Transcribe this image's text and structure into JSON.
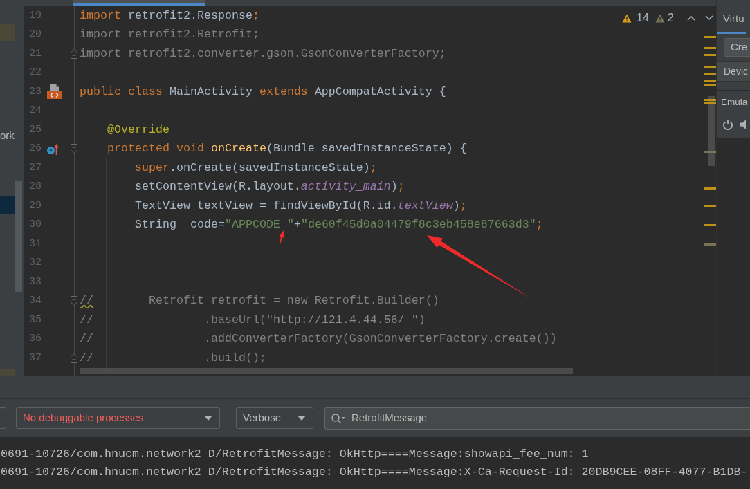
{
  "editor_tabs": [
    {
      "selected": true
    },
    {
      "selected": false
    }
  ],
  "project_tree": {
    "rows": [
      {
        "selected": false,
        "highlighted": true
      },
      {
        "label": "ork",
        "selected": false,
        "highlighted": false
      },
      {
        "selected": true,
        "highlighted": false
      },
      {
        "selected": false,
        "highlighted": true
      }
    ]
  },
  "editor": {
    "inspections": [
      {
        "kind": "warning",
        "count": "14"
      },
      {
        "kind": "weak_warning",
        "count": "2"
      }
    ],
    "lines": [
      {
        "number": "19",
        "tokens": [
          {
            "kind": "keyword",
            "text": "import"
          },
          {
            "kind": "plain",
            "text": " retrofit2.Response"
          },
          {
            "kind": "keyword",
            "text": ";"
          }
        ]
      },
      {
        "number": "20",
        "tokens": [
          {
            "kind": "unused",
            "text": "import retrofit2.Retrofit;"
          }
        ]
      },
      {
        "number": "21",
        "fold_marker": {
          "kind": "end"
        },
        "tokens": [
          {
            "kind": "unused",
            "text": "import retrofit2.converter.gson.GsonConverterFactory;"
          }
        ]
      },
      {
        "number": "22"
      },
      {
        "number": "23",
        "gutter_marker": {
          "kind": "layout"
        },
        "tokens": [
          {
            "kind": "keyword",
            "text": "public class "
          },
          {
            "kind": "plain",
            "text": "MainActivity"
          },
          {
            "kind": "keyword",
            "text": " extends "
          },
          {
            "kind": "plain",
            "text": "AppCompatActivity {"
          }
        ]
      },
      {
        "number": "24"
      },
      {
        "number": "25",
        "tokens": [
          {
            "kind": "annotation",
            "text": "    @Override"
          }
        ]
      },
      {
        "number": "26",
        "gutter_marker": {
          "kind": "override"
        },
        "fold_marker": {
          "kind": "start"
        },
        "tokens": [
          {
            "kind": "keyword",
            "text": "    protected void "
          },
          {
            "kind": "method",
            "text": "onCreate"
          },
          {
            "kind": "plain",
            "text": "(Bundle savedInstanceState) {"
          }
        ]
      },
      {
        "number": "27",
        "tokens": [
          {
            "kind": "keyword",
            "text": "        super"
          },
          {
            "kind": "plain",
            "text": ".onCreate(savedInstanceState)"
          },
          {
            "kind": "keyword",
            "text": ";"
          }
        ]
      },
      {
        "number": "28",
        "tokens": [
          {
            "kind": "plain",
            "text": "        setContentView(R.layout."
          },
          {
            "kind": "field",
            "text": "activity_main"
          },
          {
            "kind": "plain",
            "text": ")"
          },
          {
            "kind": "keyword",
            "text": ";"
          }
        ]
      },
      {
        "number": "29",
        "tokens": [
          {
            "kind": "plain",
            "text": "        TextView textView = findViewById(R.id."
          },
          {
            "kind": "field",
            "text": "textView"
          },
          {
            "kind": "plain",
            "text": ")"
          },
          {
            "kind": "keyword",
            "text": ";"
          }
        ]
      },
      {
        "number": "30",
        "tokens": [
          {
            "kind": "plain",
            "text": "        String  code="
          },
          {
            "kind": "string",
            "text": "\"APPCODE \""
          },
          {
            "kind": "plain",
            "text": "+"
          },
          {
            "kind": "string",
            "text": "\"de60f45d0a04479f8c3eb458e87663d3\""
          },
          {
            "kind": "keyword",
            "text": ";"
          }
        ]
      },
      {
        "number": "31"
      },
      {
        "number": "32"
      },
      {
        "number": "33"
      },
      {
        "number": "34",
        "fold_marker": {
          "kind": "start"
        },
        "tokens": [
          {
            "kind": "typo",
            "text": "//"
          },
          {
            "kind": "comment",
            "text": "        Retrofit retrofit = new Retrofit.Builder()"
          }
        ]
      },
      {
        "number": "35",
        "tokens": [
          {
            "kind": "comment",
            "text": "//                .baseUrl(\""
          },
          {
            "kind": "link",
            "text": "http://121.4.44.56/"
          },
          {
            "kind": "comment",
            "text": " \")"
          }
        ]
      },
      {
        "number": "36",
        "tokens": [
          {
            "kind": "comment",
            "text": "//                .addConverterFactory(GsonConverterFactory.create())"
          }
        ]
      },
      {
        "number": "37",
        "fold_marker": {
          "kind": "end"
        },
        "tokens": [
          {
            "kind": "comment",
            "text": "//                .build();"
          }
        ]
      }
    ]
  },
  "device_manager": {
    "tabs": [
      {
        "label": "Virtu",
        "selected": true
      }
    ],
    "create_button": "Cre",
    "table_header": "Devic",
    "emulator_title": "Emula"
  },
  "logcat": {
    "process": {
      "value": "No debuggable processes",
      "error": true
    },
    "level": {
      "value": "Verbose"
    },
    "filter": {
      "value": "RetrofitMessage"
    },
    "lines": [
      "0691-10726/com.hnucm.network2 D/RetrofitMessage: OkHttp====Message:showapi_fee_num: 1",
      "0691-10726/com.hnucm.network2 D/RetrofitMessage: OkHttp====Message:X-Ca-Request-Id: 20DB9CEE-08FF-4077-B1DB-"
    ]
  }
}
